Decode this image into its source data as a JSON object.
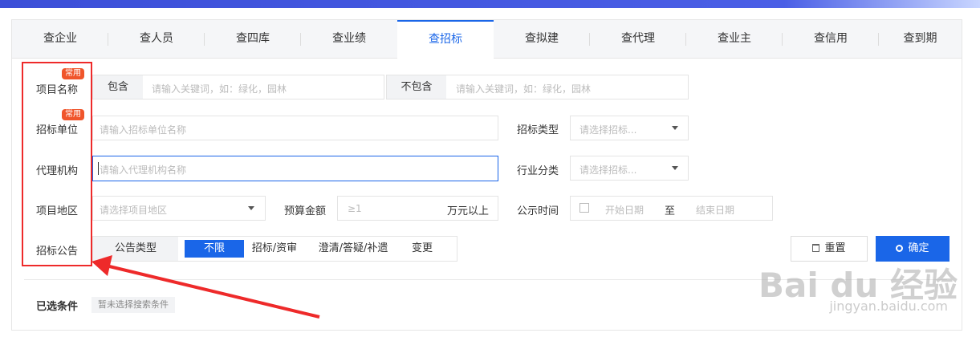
{
  "tabs": [
    "查企业",
    "查人员",
    "查四库",
    "查业绩",
    "查招标",
    "查拟建",
    "查代理",
    "查业主",
    "查信用",
    "查到期"
  ],
  "active_tab": "查招标",
  "badge": "常用",
  "form": {
    "project_name": {
      "label": "项目名称",
      "include_label": "包含",
      "include_placeholder": "请输入关键词，如：绿化，园林",
      "exclude_label": "不包含",
      "exclude_placeholder": "请输入关键词，如：绿化，园林"
    },
    "tender_unit": {
      "label": "招标单位",
      "placeholder": "请输入招标单位名称",
      "type_label": "招标类型",
      "type_placeholder": "请选择招标..."
    },
    "agency": {
      "label": "代理机构",
      "placeholder": "请输入代理机构名称",
      "industry_label": "行业分类",
      "industry_placeholder": "请选择招标..."
    },
    "region": {
      "label": "项目地区",
      "placeholder": "请选择项目地区",
      "budget_label": "预算金额",
      "budget_placeholder": "≥1",
      "budget_unit": "万元以上",
      "date_label": "公示时间",
      "start_placeholder": "开始日期",
      "date_sep": "至",
      "end_placeholder": "结束日期"
    },
    "notice": {
      "label": "招标公告",
      "type_label": "公告类型",
      "options": [
        "不限",
        "招标/资审",
        "澄清/答疑/补遗",
        "变更"
      ],
      "selected": "不限"
    }
  },
  "buttons": {
    "reset": "重置",
    "confirm": "确定"
  },
  "selected_conditions": {
    "label": "已选条件",
    "empty_text": "暂未选择搜索条件"
  },
  "colors": {
    "accent": "#1a66e8",
    "badge": "#f0552b",
    "annotation": "#ee2a2a"
  },
  "watermark": {
    "logo": "Bai du 经验",
    "url": "jingyan.baidu.com"
  }
}
